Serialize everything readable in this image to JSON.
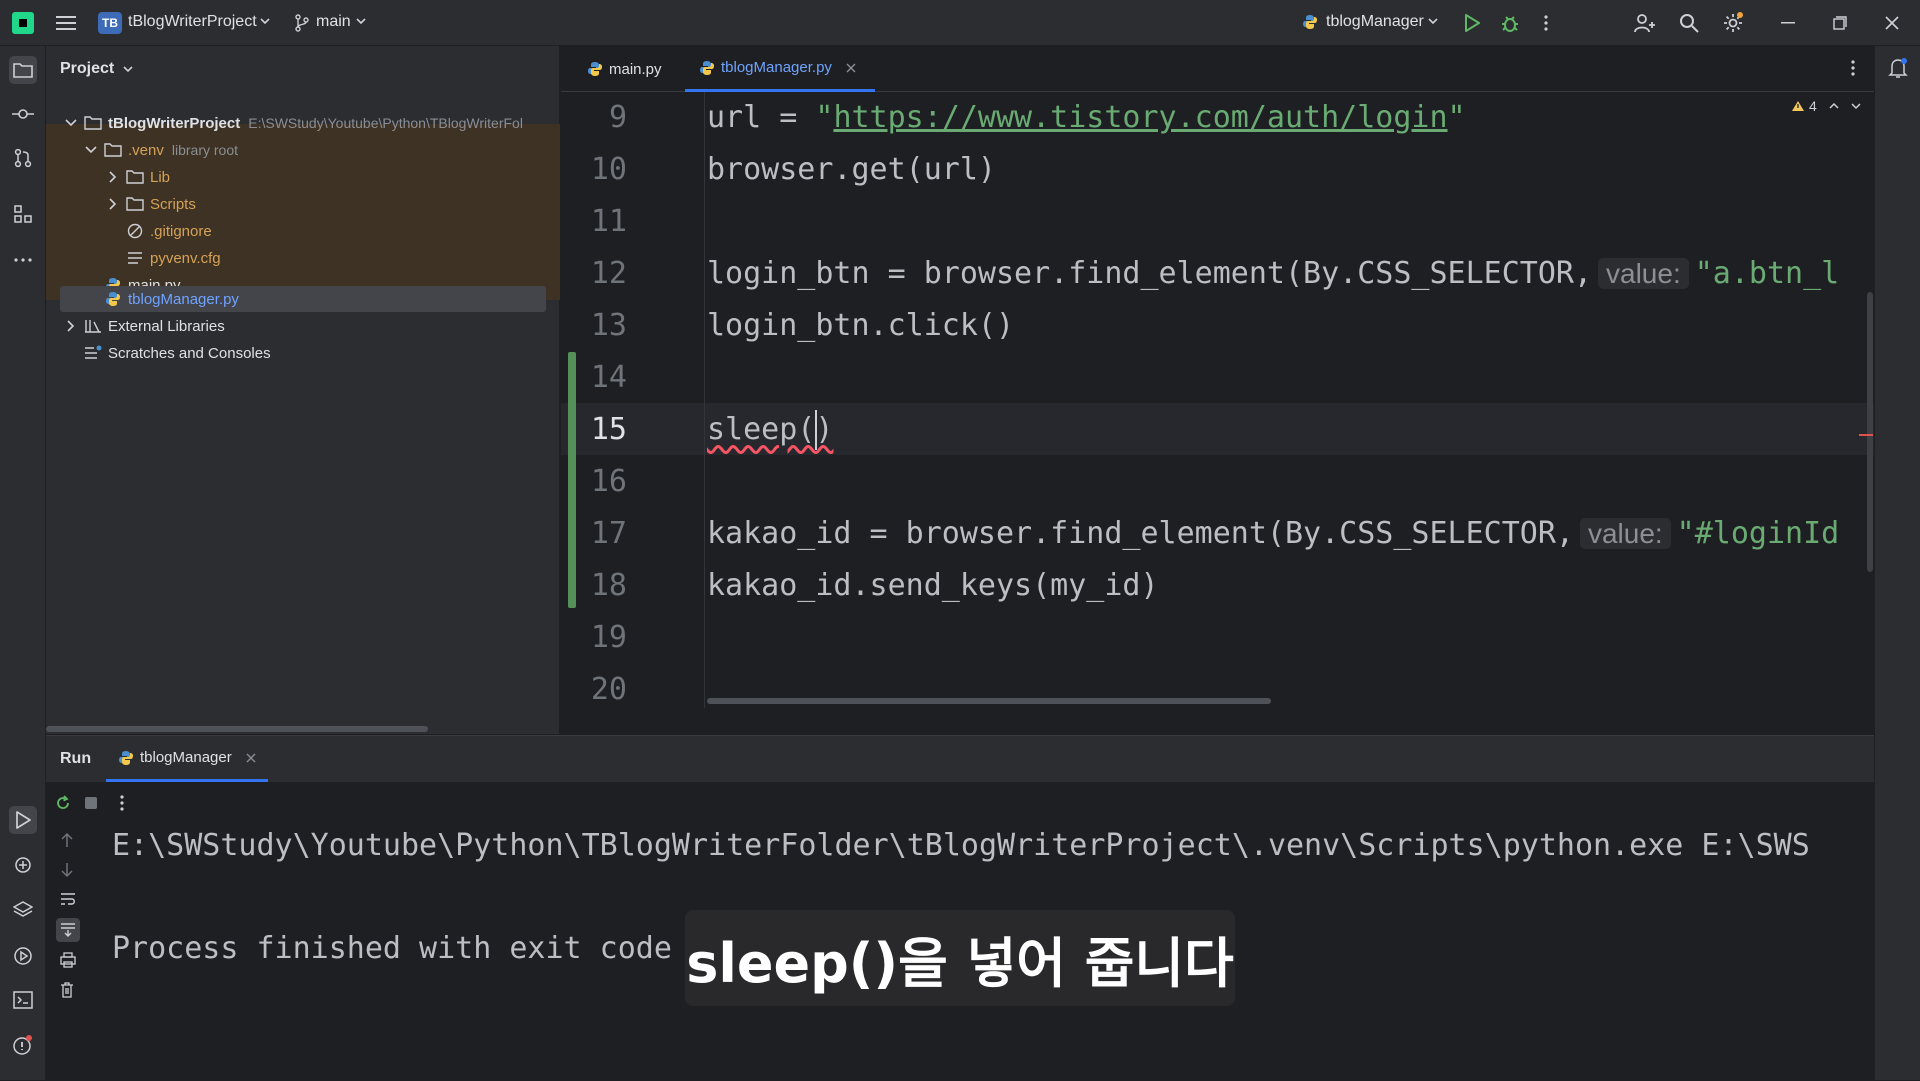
{
  "titlebar": {
    "project_badge": "TB",
    "project_name": "tBlogWriterProject",
    "branch": "main",
    "run_config": "tblogManager"
  },
  "project_panel": {
    "header": "Project",
    "root_name": "tBlogWriterProject",
    "root_path": "E:\\SWStudy\\Youtube\\Python\\TBlogWriterFol",
    "venv_name": ".venv",
    "venv_note": "library root",
    "items": [
      {
        "label": "Lib"
      },
      {
        "label": "Scripts"
      },
      {
        "label": ".gitignore"
      },
      {
        "label": "pyvenv.cfg"
      },
      {
        "label": "main.py"
      },
      {
        "label": "tblogManager.py"
      },
      {
        "label": "External Libraries"
      },
      {
        "label": "Scratches and Consoles"
      }
    ]
  },
  "editor": {
    "tabs": [
      {
        "label": "main.py"
      },
      {
        "label": "tblogManager.py"
      }
    ],
    "warning_count": "4",
    "line_numbers": [
      "9",
      "10",
      "11",
      "12",
      "13",
      "14",
      "15",
      "16",
      "17",
      "18",
      "19",
      "20"
    ],
    "code": {
      "l9_pre": "url = ",
      "l9_q1": "\"",
      "l9_url": "https://www.tistory.com/auth/login",
      "l9_q2": "\"",
      "l10": "browser.get(url)",
      "l12_pre": "login_btn = browser.find_element(By.CSS_SELECTOR,",
      "l12_hint": "value:",
      "l12_str": "\"a.btn_l",
      "l13": "login_btn.click()",
      "l15": "sleep()",
      "l17_pre": "kakao_id = browser.find_element(By.CSS_SELECTOR,",
      "l17_hint": "value:",
      "l17_str": "\"#loginId",
      "l18": "kakao_id.send_keys(my_id)"
    }
  },
  "run_panel": {
    "title": "Run",
    "tab": "tblogManager",
    "output_line1": "E:\\SWStudy\\Youtube\\Python\\TBlogWriterFolder\\tBlogWriterProject\\.venv\\Scripts\\python.exe E:\\SWS",
    "output_line2": "Process finished with exit code"
  },
  "subtitle": "sleep()을 넣어 줍니다",
  "colors": {
    "accent": "#3574f0",
    "string": "#6aab73",
    "run_green": "#5fb865",
    "venv_highlight": "#3d3223"
  }
}
